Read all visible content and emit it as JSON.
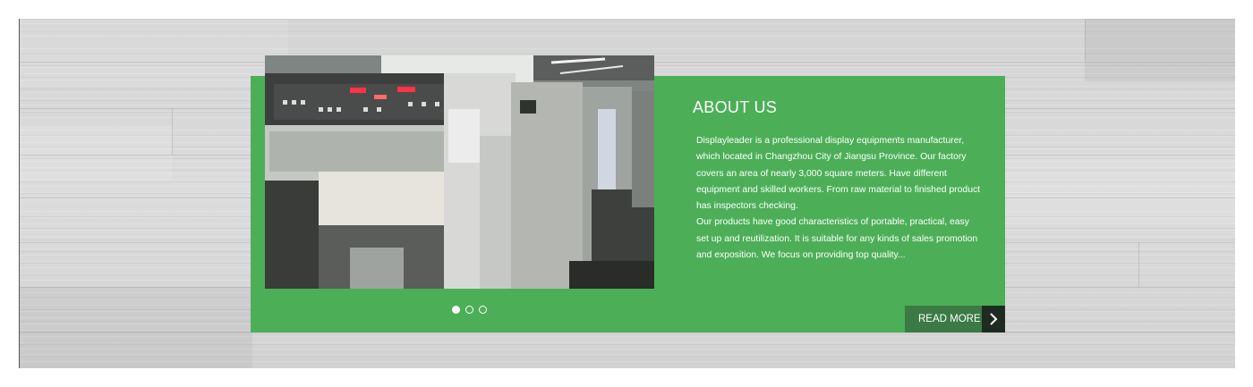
{
  "about": {
    "title": "ABOUT US",
    "paragraph_1": "Displayleader is a professional display equipments manufacturer, which located in Changzhou City of Jiangsu Province. Our factory covers an area of nearly 3,000 square meters. Have different equipment and skilled workers. From raw material to finished product has inspectors checking.",
    "paragraph_2": "Our products have good characteristics of portable, practical, easy set up and reutilization. It is suitable for any kinds of sales promotion and exposition. We focus on providing top quality...",
    "read_more_label": "READ MORE"
  },
  "slider": {
    "slide_count": 3,
    "active_index": 0,
    "image_icon": "printing-machine-photo"
  },
  "colors": {
    "green_panel": "#4caf57",
    "read_more_bg": "#3b7a45",
    "read_more_arrow_bg": "#1d2b20",
    "text": "#ffffff"
  },
  "icons": {
    "read_more_arrow": "chevron-right-icon"
  }
}
